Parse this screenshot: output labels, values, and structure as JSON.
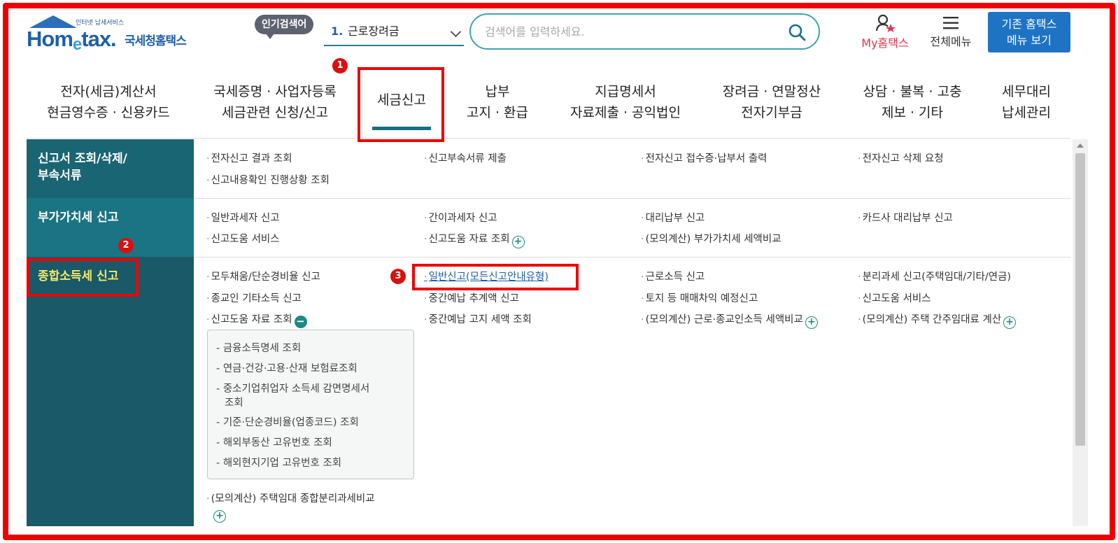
{
  "header": {
    "logo_small": "인터넷 납세서비스",
    "logo_word_a": "Hom",
    "logo_word_e": "e",
    "logo_word_b": "tax.",
    "logo_kr": "국세청홈택스",
    "popular_badge": "인기검색어",
    "popular_rank": "1.",
    "popular_term": "근로장려금",
    "search_placeholder": "검색어를 입력하세요.",
    "my_hometax": "My홈택스",
    "all_menu": "전체메뉴",
    "old_menu_line1": "기존 홈택스",
    "old_menu_line2": "메뉴 보기"
  },
  "gnb": [
    {
      "line1": "전자(세금)계산서",
      "line2": "현금영수증 · 신용카드"
    },
    {
      "line1": "국세증명 · 사업자등록",
      "line2": "세금관련 신청/신고"
    },
    {
      "line1": "세금신고",
      "line2": ""
    },
    {
      "line1": "납부",
      "line2": "고지 · 환급"
    },
    {
      "line1": "지급명세서",
      "line2": "자료제출 · 공익법인"
    },
    {
      "line1": "장려금 · 연말정산",
      "line2": "전자기부금"
    },
    {
      "line1": "상담 · 불복 · 고충",
      "line2": "제보 · 기타"
    },
    {
      "line1": "세무대리",
      "line2": "납세관리"
    }
  ],
  "markers": [
    "1",
    "2",
    "3"
  ],
  "sidebar": [
    {
      "line1": "신고서 조회/삭제/",
      "line2": "부속서류"
    },
    {
      "line1": "부가가치세 신고",
      "line2": ""
    },
    {
      "line1": "종합소득세 신고",
      "line2": ""
    }
  ],
  "row1": [
    "전자신고 결과 조회",
    "신고부속서류 제출",
    "전자신고 접수증·납부서 출력",
    "전자신고 삭제 요청",
    "신고내용확인 진행상황 조회"
  ],
  "row2": [
    "일반과세자 신고",
    "간이과세자 신고",
    "대리납부 신고",
    "카드사 대리납부 신고",
    "신고도움 서비스",
    "신고도움 자료 조회",
    "(모의계산) 부가가치세 세액비교"
  ],
  "row3": [
    "모두채움/단순경비율 신고",
    "일반신고(모든신고안내유형)",
    "근로소득 신고",
    "분리과세 신고(주택임대/기타/연금)",
    "종교인 기타소득 신고",
    "중간예납 추계액 신고",
    "토지 등 매매차익 예정신고",
    "신고도움 서비스",
    "신고도움 자료 조회",
    "중간예납 고지 세액 조회",
    "(모의계산) 근로·종교인소득 세액비교",
    "(모의계산) 주택 간주임대료 계산",
    "(모의계산) 주택임대 종합분리과세비교"
  ],
  "subpanel": [
    "금융소득명세 조회",
    "연금·건강·고용·산재 보험료조회",
    "중소기업취업자 소득세 감면명세서",
    "조회",
    "기준·단순경비율(업종코드) 조회",
    "해외부동산 고유번호 조회",
    "해외현지기업 고유번호 조회"
  ],
  "symbols": {
    "bullet": "·",
    "dash": "-",
    "plus": "+",
    "minus": "−"
  }
}
